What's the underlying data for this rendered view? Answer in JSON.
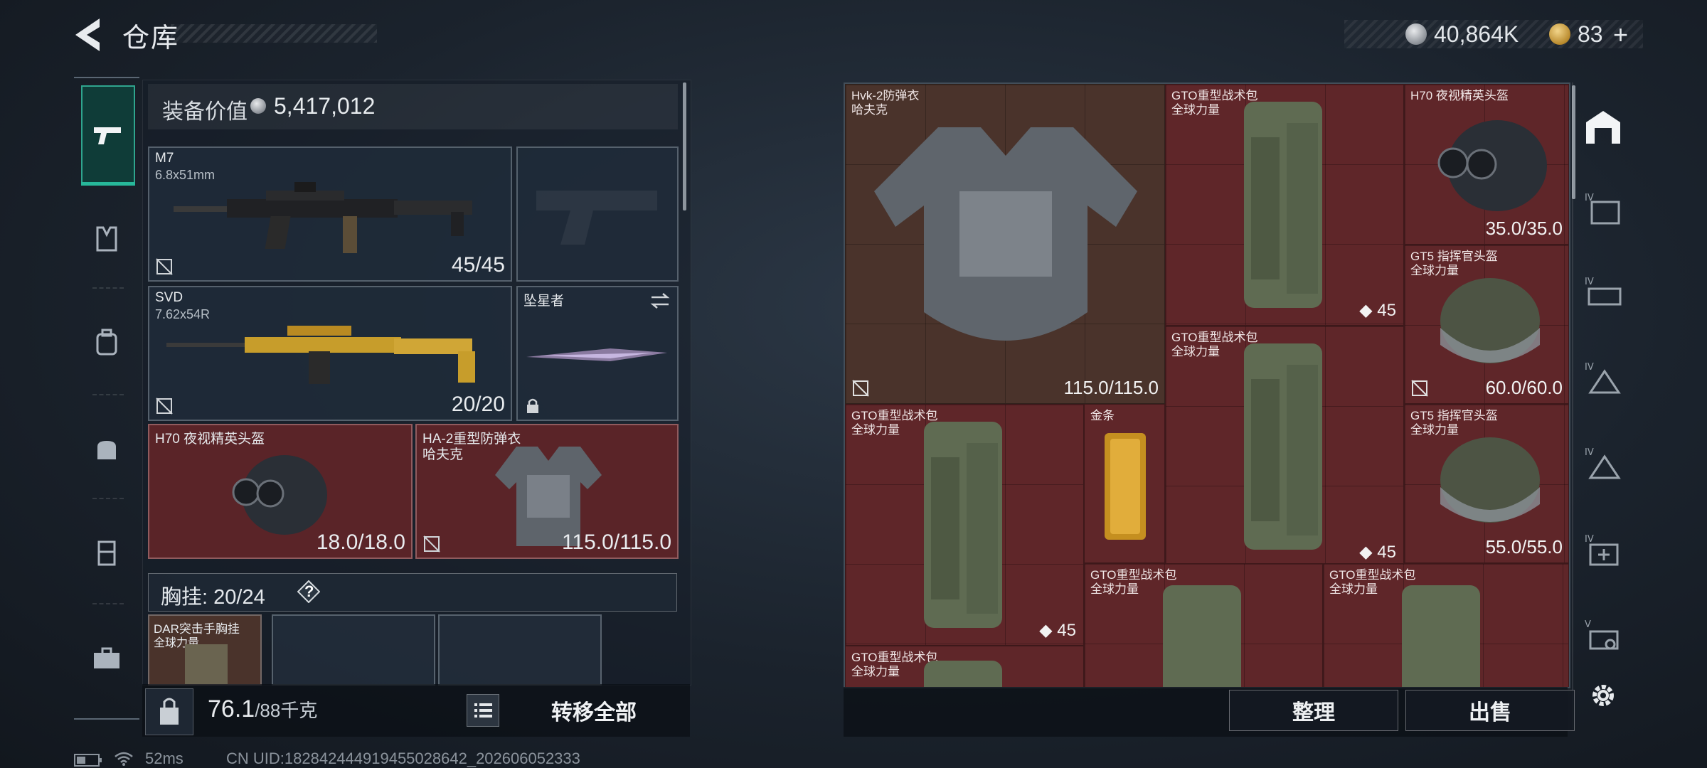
{
  "header": {
    "title": "仓库",
    "silver_amount": "40,864K",
    "gold_amount": "83",
    "add_symbol": "+"
  },
  "loadout": {
    "equipment_value_label": "装备价值",
    "equipment_value": "5,417,012",
    "primary_weapon": {
      "name": "M7",
      "caliber": "6.8x51mm",
      "ammo": "45/45"
    },
    "secondary_weapon": {
      "name": "SVD",
      "caliber": "7.62x54R",
      "ammo": "20/20"
    },
    "melee": {
      "name": "坠星者"
    },
    "helmet": {
      "name": "H70 夜视精英头盔",
      "durability": "18.0/18.0"
    },
    "armor": {
      "name": "HA-2重型防弹衣",
      "brand": "哈夫克",
      "durability": "115.0/115.0"
    },
    "chest_rig_label": "胸挂:",
    "chest_rig_capacity": "20/24",
    "help_symbol": "?",
    "chest_rig": {
      "name": "DAR突击手胸挂",
      "brand": "全球力量"
    },
    "weight_current": "76.1",
    "weight_max": "/88千克",
    "transfer_all_label": "转移全部"
  },
  "storage": {
    "items": [
      {
        "name": "Hvk-2防弹衣",
        "brand": "哈夫克",
        "value": "115.0/115.0"
      },
      {
        "name": "GTO重型战术包",
        "brand": "全球力量",
        "count": "45"
      },
      {
        "name": "H70 夜视精英头盔",
        "brand": "",
        "value": "35.0/35.0"
      },
      {
        "name": "GT5 指挥官头盔",
        "brand": "全球力量",
        "value": "60.0/60.0"
      },
      {
        "name": "GTO重型战术包",
        "brand": "全球力量",
        "count": "45"
      },
      {
        "name": "GTO重型战术包",
        "brand": "全球力量",
        "count": "45"
      },
      {
        "name": "金条",
        "brand": ""
      },
      {
        "name": "GT5 指挥官头盔",
        "brand": "全球力量",
        "value": "55.0/55.0"
      },
      {
        "name": "GTO重型战术包",
        "brand": "全球力量"
      },
      {
        "name": "GTO重型战术包",
        "brand": "全球力量"
      },
      {
        "name": "GTO重型战术包",
        "brand": "全球力量"
      }
    ],
    "sort_label": "整理",
    "sell_label": "出售",
    "tab_labels": [
      "IV",
      "IV",
      "IV",
      "IV",
      "IV",
      "V"
    ]
  },
  "status_bar": {
    "ping": "52ms",
    "uid": "CN UID:18284244491945502864​2_202606052333"
  },
  "colors": {
    "accent": "#27b89a",
    "item_red": "#5f2629",
    "item_brown": "#4a332b"
  }
}
